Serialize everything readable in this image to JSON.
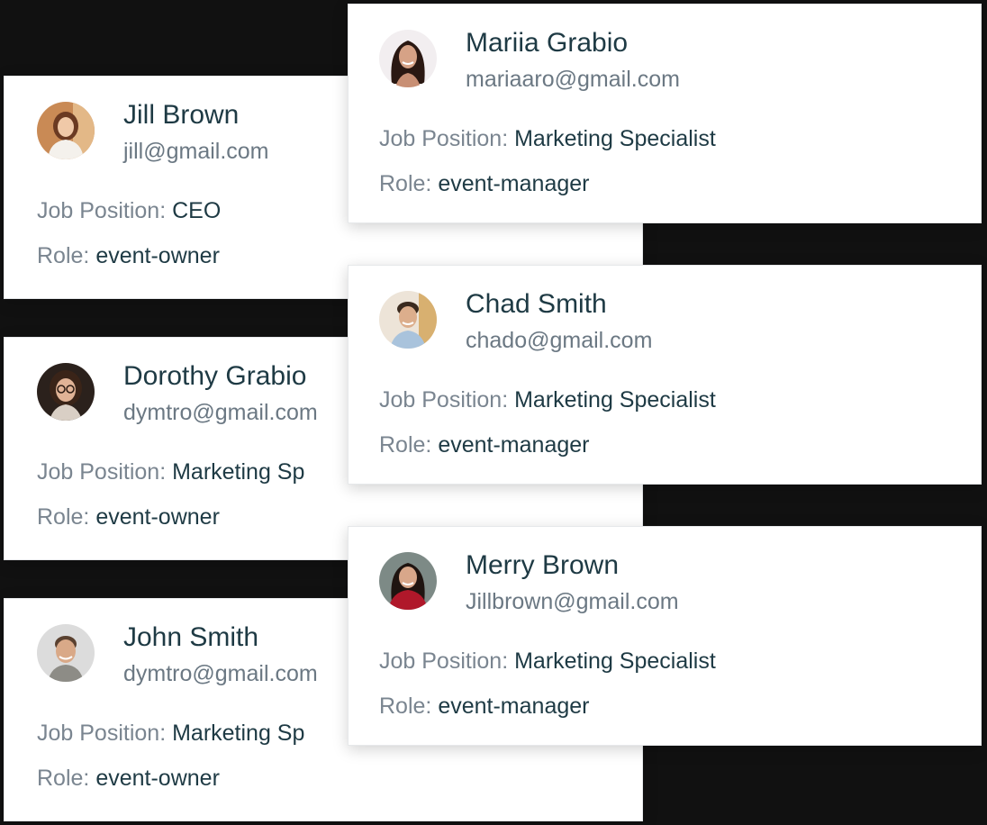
{
  "labels": {
    "job_position": "Job Position:",
    "role": "Role:"
  },
  "left_cards": [
    {
      "name": "Jill Brown",
      "email": "jill@gmail.com",
      "job_position": "CEO",
      "role": "event-owner",
      "avatar": "woman-office-avatar"
    },
    {
      "name": "Dorothy Grabio",
      "email": "dymtro@gmail.com",
      "job_position": "Marketing Sp",
      "role": "event-owner",
      "avatar": "woman-glasses-avatar"
    },
    {
      "name": "John Smith",
      "email": "dymtro@gmail.com",
      "job_position": "Marketing Sp",
      "role": "event-owner",
      "avatar": "man-smiling-avatar"
    }
  ],
  "right_cards": [
    {
      "name": "Mariia Grabio",
      "email": "mariaaro@gmail.com",
      "job_position": "Marketing Specialist",
      "role": "event-manager",
      "avatar": "woman-long-hair-avatar"
    },
    {
      "name": "Chad Smith",
      "email": "chado@gmail.com",
      "job_position": "Marketing Specialist",
      "role": "event-manager",
      "avatar": "man-shirt-avatar"
    },
    {
      "name": "Merry Brown",
      "email": "Jillbrown@gmail.com",
      "job_position": "Marketing Specialist",
      "role": "event-manager",
      "avatar": "woman-red-top-avatar"
    }
  ],
  "colors": {
    "name": "#1e3a44",
    "email": "#6b7883",
    "label": "#7a8590",
    "value": "#1e3a44",
    "card_bg": "#ffffff",
    "page_bg": "#111111"
  }
}
